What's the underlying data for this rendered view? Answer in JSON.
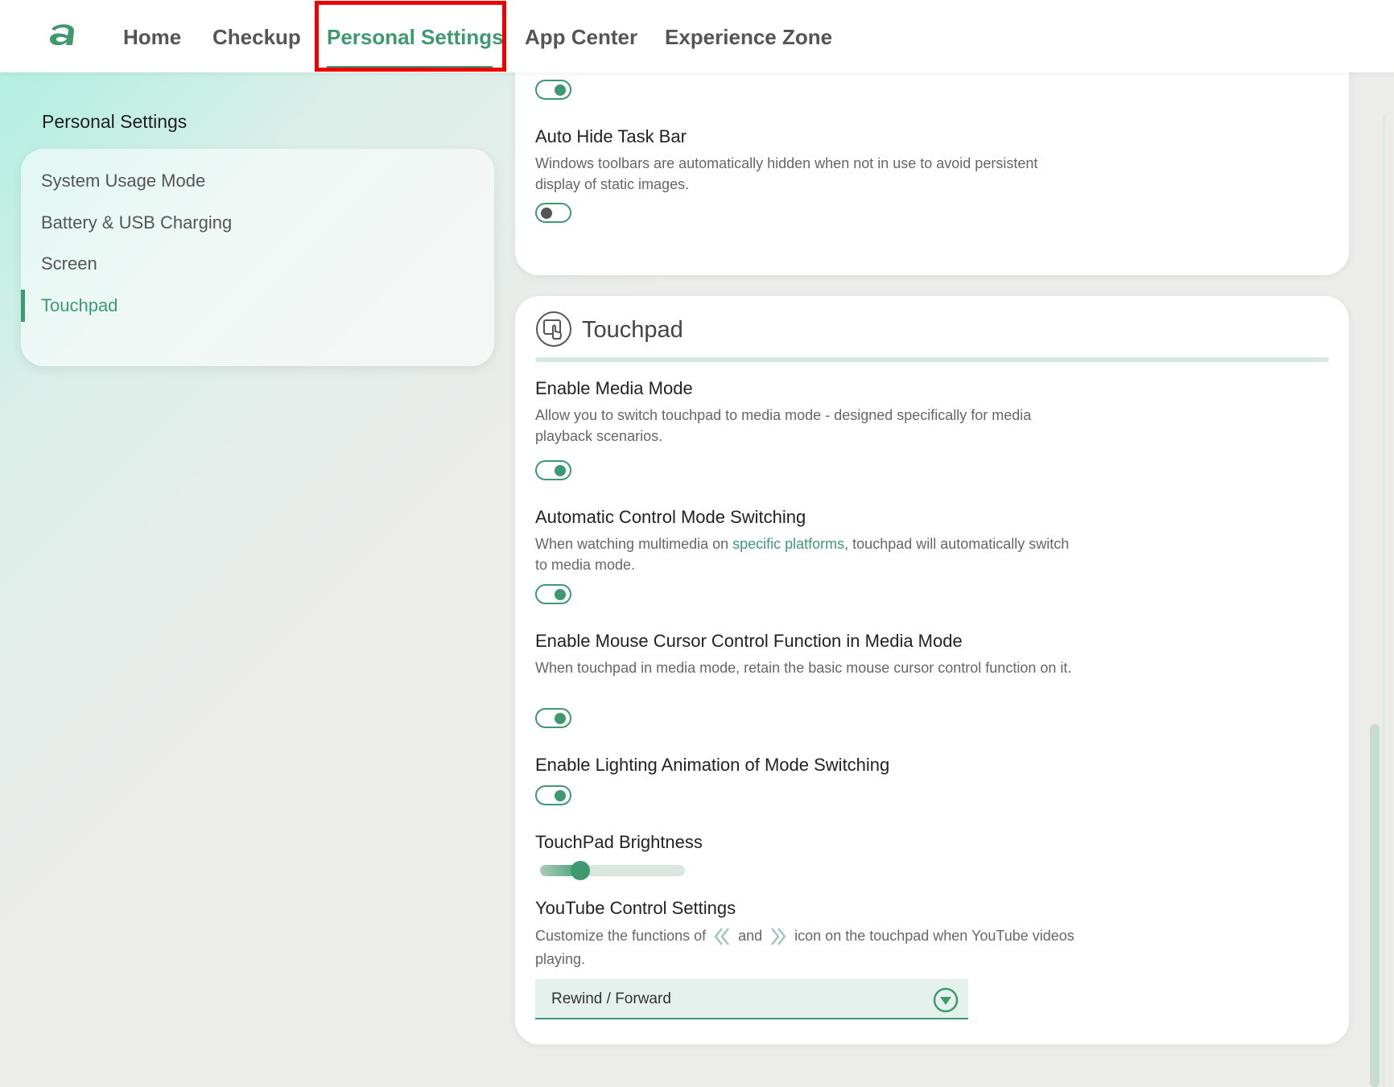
{
  "nav": {
    "items": [
      {
        "label": "Home"
      },
      {
        "label": "Checkup"
      },
      {
        "label": "Personal Settings"
      },
      {
        "label": "App Center"
      },
      {
        "label": "Experience Zone"
      }
    ],
    "active": "Personal Settings",
    "logo_icon": "brand-a-logo"
  },
  "sidebar": {
    "title": "Personal Settings",
    "items": [
      {
        "label": "System Usage Mode"
      },
      {
        "label": "Battery & USB Charging"
      },
      {
        "label": "Screen"
      },
      {
        "label": "Touchpad"
      }
    ],
    "active": "Touchpad"
  },
  "screen_section": {
    "top_toggle_on": true,
    "auto_hide": {
      "title": "Auto Hide Task Bar",
      "desc": "Windows toolbars are automatically hidden when not in use to avoid persistent display of static images.",
      "on": false
    }
  },
  "touchpad": {
    "title": "Touchpad",
    "icon": "touchpad-icon",
    "media_mode": {
      "title": "Enable Media Mode",
      "desc": "Allow you to switch touchpad to media mode - designed specifically for media playback scenarios.",
      "on": true
    },
    "auto_switch": {
      "title": "Automatic Control Mode Switching",
      "desc_before": "When watching multimedia on ",
      "desc_link": "specific platforms",
      "desc_after": ", touchpad will automatically switch to media mode.",
      "on": true
    },
    "cursor_control": {
      "title": "Enable Mouse Cursor Control Function in Media Mode",
      "desc": "When touchpad in media mode, retain the basic mouse cursor control function on it.",
      "on": true
    },
    "lighting": {
      "title": "Enable Lighting Animation of Mode Switching",
      "on": true
    },
    "brightness": {
      "title": "TouchPad Brightness",
      "level": 0.28
    },
    "youtube": {
      "title": "YouTube Control Settings",
      "desc_1": "Customize the functions of ",
      "desc_2": " and ",
      "desc_3": " icon on the touchpad when YouTube videos playing.",
      "selected": "Rewind / Forward"
    }
  },
  "colors": {
    "accent": "#3e9a6e",
    "highlight": "#ee0000"
  }
}
